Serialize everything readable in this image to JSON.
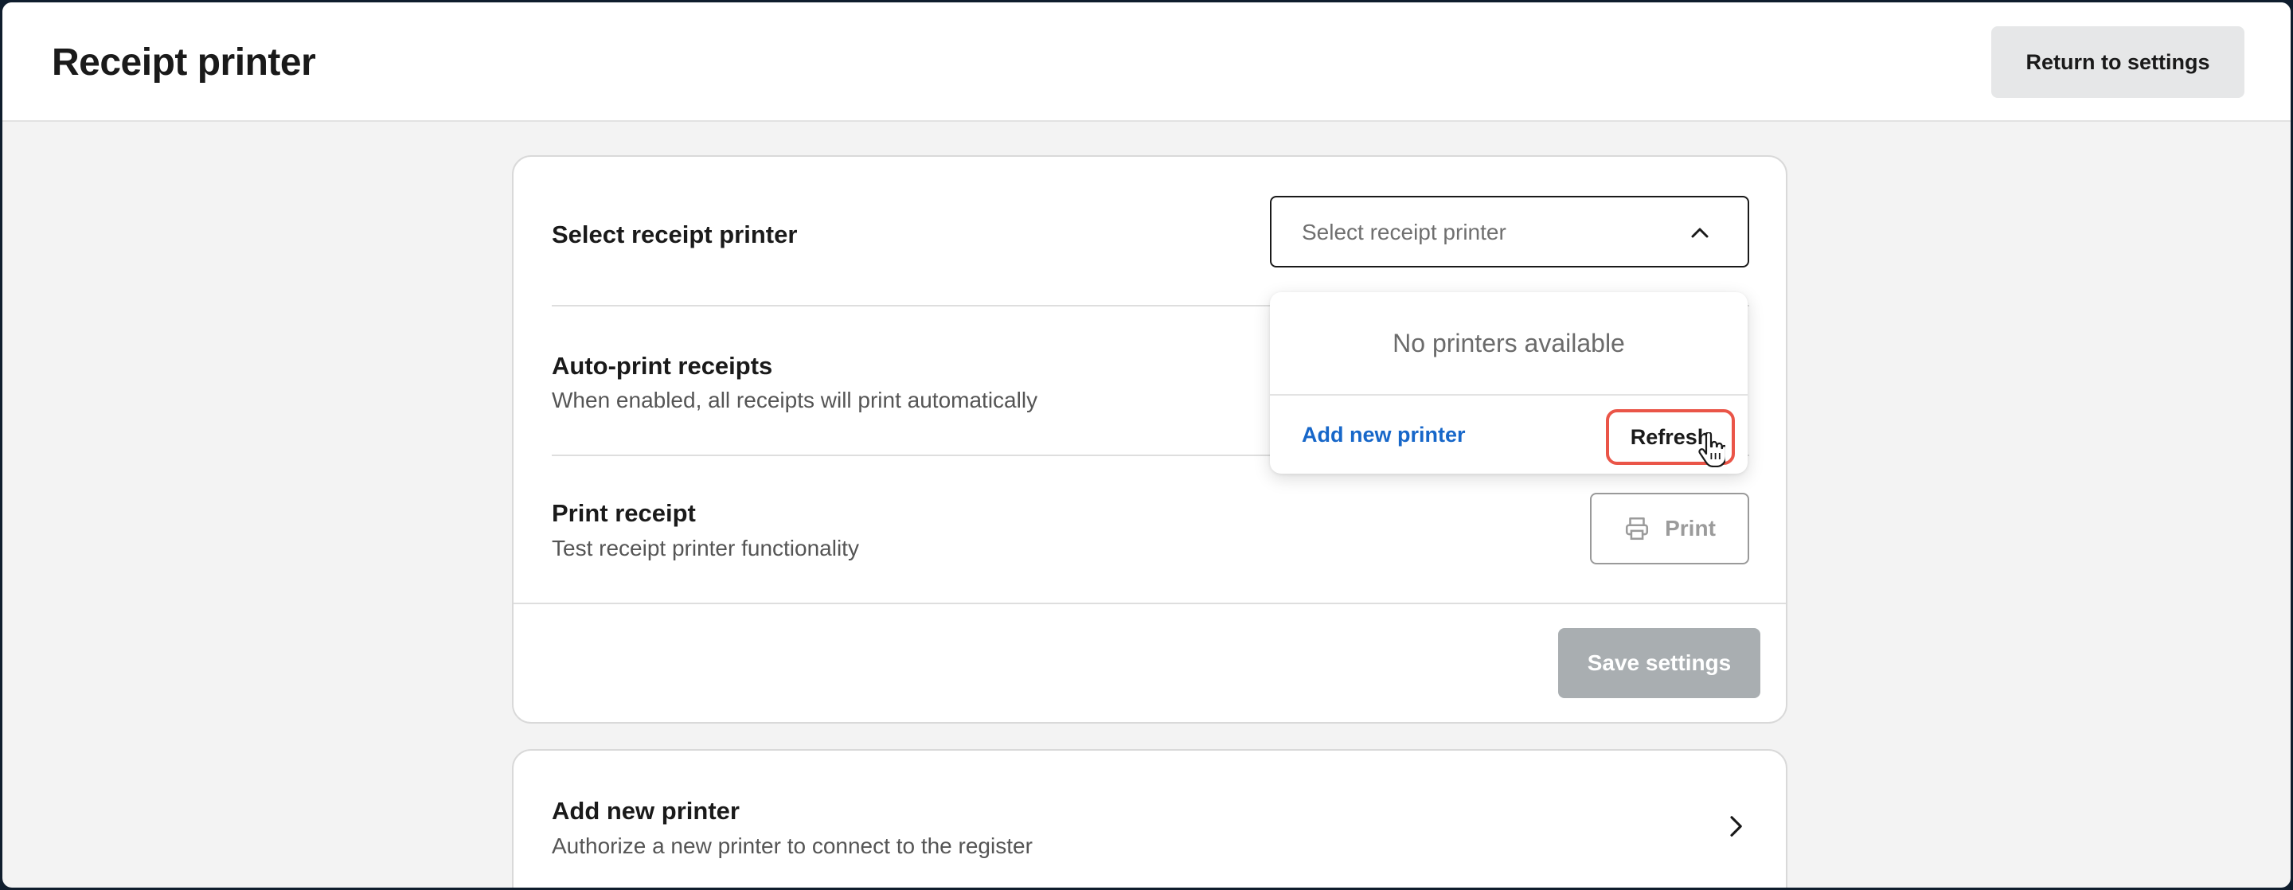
{
  "header": {
    "title": "Receipt printer",
    "return_label": "Return to settings"
  },
  "settings_card": {
    "select_printer": {
      "label": "Select receipt printer",
      "placeholder": "Select receipt printer",
      "dropdown_open": true
    },
    "auto_print": {
      "title": "Auto-print receipts",
      "subtitle": "When enabled, all receipts will print automatically"
    },
    "print_receipt": {
      "title": "Print receipt",
      "subtitle": "Test receipt printer functionality",
      "button_label": "Print",
      "button_icon": "printer-icon"
    },
    "save_label": "Save settings"
  },
  "dropdown": {
    "empty_message": "No printers available",
    "add_link": "Add new printer",
    "refresh_label": "Refresh"
  },
  "add_printer_card": {
    "title": "Add new printer",
    "subtitle": "Authorize a new printer to connect to the register",
    "icon": "chevron-right-icon"
  },
  "colors": {
    "background": "#f3f3f3",
    "link": "#1767c9",
    "highlight": "#ea5548",
    "disabled_button": "#a9aeb1"
  }
}
